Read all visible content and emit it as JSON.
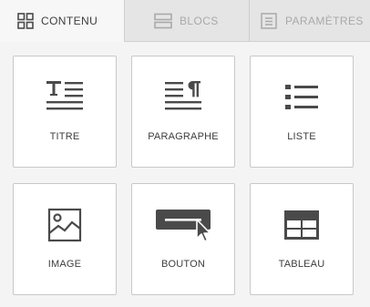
{
  "tabs": [
    {
      "label": "CONTENU",
      "icon": "grid-icon",
      "active": true
    },
    {
      "label": "BLOCS",
      "icon": "blocks-icon",
      "active": false
    },
    {
      "label": "PARAMÈTRES",
      "icon": "settings-document-icon",
      "active": false
    }
  ],
  "content_items": [
    {
      "label": "TITRE",
      "icon": "title-icon"
    },
    {
      "label": "PARAGRAPHE",
      "icon": "paragraph-icon"
    },
    {
      "label": "LISTE",
      "icon": "list-icon"
    },
    {
      "label": "IMAGE",
      "icon": "image-icon"
    },
    {
      "label": "BOUTON",
      "icon": "button-icon"
    },
    {
      "label": "TABLEAU",
      "icon": "table-icon"
    }
  ],
  "colors": {
    "icon": "#4a4a4a",
    "inactive_tab_bg": "#e5e5e5",
    "inactive_text": "#a9a9a9",
    "page_bg": "#f4f4f4"
  }
}
